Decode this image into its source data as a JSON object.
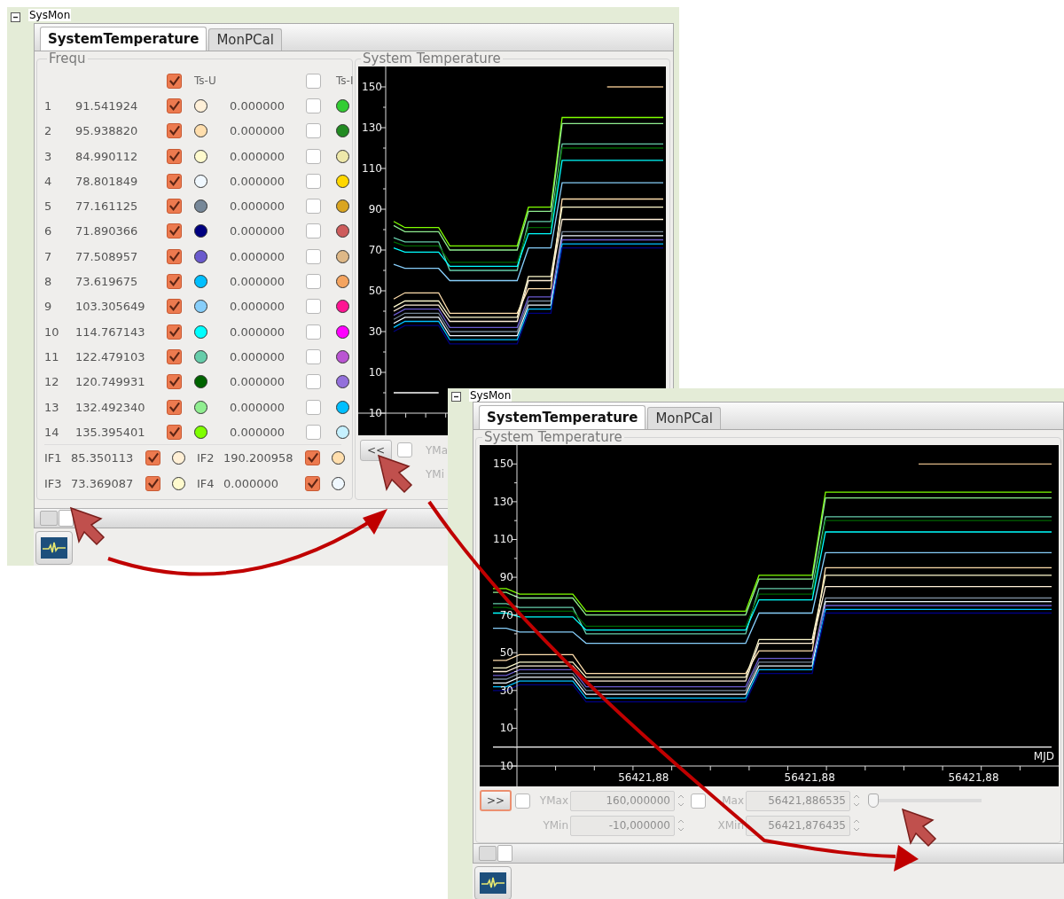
{
  "back_window": {
    "title": "SysMon",
    "tabs": [
      {
        "label": "SystemTemperature",
        "selected": true
      },
      {
        "label": "MonPCal",
        "selected": false
      }
    ],
    "frequency_panel": {
      "title": "Frequ",
      "header": {
        "upper": {
          "checked": true,
          "label": "Ts-U"
        },
        "lower": {
          "checked": false,
          "label": "Ts-I"
        }
      },
      "rows": [
        {
          "index": "1",
          "frequency": "91.541924",
          "upper": {
            "checked": true,
            "color": "#fff0d8"
          },
          "value": "0.000000",
          "lower": {
            "checked": false,
            "color": "#32cd32"
          }
        },
        {
          "index": "2",
          "frequency": "95.938820",
          "upper": {
            "checked": true,
            "color": "#ffdead"
          },
          "value": "0.000000",
          "lower": {
            "checked": false,
            "color": "#228b22"
          }
        },
        {
          "index": "3",
          "frequency": "84.990112",
          "upper": {
            "checked": true,
            "color": "#fffacd"
          },
          "value": "0.000000",
          "lower": {
            "checked": false,
            "color": "#eee8aa"
          }
        },
        {
          "index": "4",
          "frequency": "78.801849",
          "upper": {
            "checked": true,
            "color": "#f0f8ff"
          },
          "value": "0.000000",
          "lower": {
            "checked": false,
            "color": "#ffd700"
          }
        },
        {
          "index": "5",
          "frequency": "77.161125",
          "upper": {
            "checked": true,
            "color": "#778899"
          },
          "value": "0.000000",
          "lower": {
            "checked": false,
            "color": "#daa520"
          }
        },
        {
          "index": "6",
          "frequency": "71.890366",
          "upper": {
            "checked": true,
            "color": "#000080"
          },
          "value": "0.000000",
          "lower": {
            "checked": false,
            "color": "#cd5c5c"
          }
        },
        {
          "index": "7",
          "frequency": "77.508957",
          "upper": {
            "checked": true,
            "color": "#6a5acd"
          },
          "value": "0.000000",
          "lower": {
            "checked": false,
            "color": "#deb887"
          }
        },
        {
          "index": "8",
          "frequency": "73.619675",
          "upper": {
            "checked": true,
            "color": "#00bfff"
          },
          "value": "0.000000",
          "lower": {
            "checked": false,
            "color": "#f4a460"
          }
        },
        {
          "index": "9",
          "frequency": "103.305649",
          "upper": {
            "checked": true,
            "color": "#87cefa"
          },
          "value": "0.000000",
          "lower": {
            "checked": false,
            "color": "#ff1493"
          }
        },
        {
          "index": "10",
          "frequency": "114.767143",
          "upper": {
            "checked": true,
            "color": "#00ffff"
          },
          "value": "0.000000",
          "lower": {
            "checked": false,
            "color": "#ff00ff"
          }
        },
        {
          "index": "11",
          "frequency": "122.479103",
          "upper": {
            "checked": true,
            "color": "#66cdaa"
          },
          "value": "0.000000",
          "lower": {
            "checked": false,
            "color": "#ba55d3"
          }
        },
        {
          "index": "12",
          "frequency": "120.749931",
          "upper": {
            "checked": true,
            "color": "#006400"
          },
          "value": "0.000000",
          "lower": {
            "checked": false,
            "color": "#9370db"
          }
        },
        {
          "index": "13",
          "frequency": "132.492340",
          "upper": {
            "checked": true,
            "color": "#90ee90"
          },
          "value": "0.000000",
          "lower": {
            "checked": false,
            "color": "#00bfff"
          }
        },
        {
          "index": "14",
          "frequency": "135.395401",
          "upper": {
            "checked": true,
            "color": "#7fff00"
          },
          "value": "0.000000",
          "lower": {
            "checked": false,
            "color": "#c6f1ff"
          }
        }
      ],
      "if_rows": [
        {
          "label": "IF1",
          "value": "85.350113",
          "checked": true,
          "color": "#ffefd5"
        },
        {
          "label": "IF2",
          "value": "190.200958",
          "checked": true,
          "color": "#ffdead"
        },
        {
          "label": "IF3",
          "value": "73.369087",
          "checked": true,
          "color": "#fffacd"
        },
        {
          "label": "IF4",
          "value": "0.000000",
          "checked": true,
          "color": "#f0f8ff"
        }
      ]
    },
    "chart_panel": {
      "title": "System Temperature",
      "chart_data": {
        "type": "line",
        "ylim": [
          -10,
          160
        ],
        "categories": [
          null,
          null,
          null,
          null,
          null,
          null,
          null,
          null,
          null,
          null,
          null,
          null,
          null,
          null,
          null,
          null,
          null,
          null,
          null,
          null,
          null,
          null,
          null,
          null,
          null
        ],
        "yticks": [
          150,
          130,
          110,
          90,
          70,
          50,
          30,
          10,
          {
            "value": -10,
            "label": "10"
          }
        ],
        "series": [
          {
            "color": "#7fff00",
            "values": [
              84,
              81,
              81,
              81,
              81,
              72,
              72,
              72,
              72,
              72,
              72,
              72,
              91,
              91,
              91,
              135,
              135,
              135,
              135,
              135,
              135,
              135,
              135,
              135,
              135
            ]
          },
          {
            "color": "#90ee90",
            "values": [
              82,
              79,
              79,
              79,
              79,
              70,
              70,
              70,
              70,
              70,
              70,
              70,
              89,
              89,
              89,
              132,
              132,
              132,
              132,
              132,
              132,
              132,
              132,
              132,
              132
            ]
          },
          {
            "color": "#66cdaa",
            "values": [
              76,
              74,
              74,
              74,
              74,
              60,
              60,
              60,
              60,
              60,
              60,
              60,
              84,
              84,
              84,
              122,
              122,
              122,
              122,
              122,
              122,
              122,
              122,
              122,
              122
            ]
          },
          {
            "color": "#006400",
            "values": [
              74,
              72,
              72,
              72,
              72,
              64,
              64,
              64,
              64,
              64,
              64,
              64,
              81,
              81,
              81,
              120,
              120,
              120,
              120,
              120,
              120,
              120,
              120,
              120,
              120
            ]
          },
          {
            "color": "#00ffff",
            "values": [
              71,
              69,
              69,
              69,
              69,
              62,
              62,
              62,
              62,
              62,
              62,
              62,
              78,
              78,
              78,
              114,
              114,
              114,
              114,
              114,
              114,
              114,
              114,
              114,
              114
            ]
          },
          {
            "color": "#87cefa",
            "values": [
              63,
              61,
              61,
              61,
              61,
              55,
              55,
              55,
              55,
              55,
              55,
              55,
              71,
              71,
              71,
              103,
              103,
              103,
              103,
              103,
              103,
              103,
              103,
              103,
              103
            ]
          },
          {
            "color": "#ffdead",
            "values": [
              46,
              49,
              49,
              49,
              49,
              39,
              39,
              39,
              39,
              39,
              39,
              39,
              51,
              51,
              51,
              95,
              95,
              95,
              95,
              95,
              95,
              95,
              95,
              95,
              95
            ]
          },
          {
            "color": "#fffacd",
            "values": [
              42,
              45,
              45,
              45,
              45,
              37,
              37,
              37,
              37,
              37,
              37,
              37,
              57,
              57,
              57,
              91,
              91,
              91,
              91,
              91,
              91,
              91,
              91,
              91,
              91
            ]
          },
          {
            "color": "#fff0d8",
            "values": [
              40,
              43,
              43,
              43,
              43,
              35,
              35,
              35,
              35,
              35,
              35,
              35,
              55,
              55,
              55,
              85,
              85,
              85,
              85,
              85,
              85,
              85,
              85,
              85,
              85
            ]
          },
          {
            "color": "#deb887",
            "values": [
              null,
              null,
              null,
              null,
              null,
              null,
              null,
              null,
              null,
              null,
              null,
              null,
              null,
              null,
              null,
              null,
              null,
              null,
              null,
              150,
              150,
              150,
              150,
              150,
              150
            ]
          },
          {
            "color": "#778899",
            "values": [
              36,
              39,
              39,
              39,
              39,
              30,
              30,
              30,
              30,
              30,
              30,
              30,
              45,
              45,
              45,
              79,
              79,
              79,
              79,
              79,
              79,
              79,
              79,
              79,
              79
            ]
          },
          {
            "color": "#f0f8ff",
            "values": [
              34,
              37,
              37,
              37,
              37,
              28,
              28,
              28,
              28,
              28,
              28,
              28,
              43,
              43,
              43,
              77,
              77,
              77,
              77,
              77,
              77,
              77,
              77,
              77,
              77
            ]
          },
          {
            "color": "#6a5acd",
            "values": [
              38,
              41,
              41,
              41,
              41,
              32,
              32,
              32,
              32,
              32,
              32,
              32,
              47,
              47,
              47,
              75,
              75,
              75,
              75,
              75,
              75,
              75,
              75,
              75,
              75
            ]
          },
          {
            "color": "#00bfff",
            "values": [
              32,
              35,
              35,
              35,
              35,
              26,
              26,
              26,
              26,
              26,
              26,
              26,
              41,
              41,
              41,
              73,
              73,
              73,
              73,
              73,
              73,
              73,
              73,
              73,
              73
            ]
          },
          {
            "color": "#000080",
            "values": [
              30,
              33,
              33,
              33,
              33,
              24,
              24,
              24,
              24,
              24,
              24,
              24,
              39,
              39,
              39,
              71,
              71,
              71,
              71,
              71,
              71,
              71,
              71,
              71,
              71
            ]
          },
          {
            "color": "#ffffff",
            "values": [
              0,
              0,
              0,
              0,
              0,
              null,
              null,
              null,
              null,
              null,
              null,
              null,
              null,
              null,
              null,
              null,
              null,
              null,
              null,
              null,
              null,
              null,
              null,
              null,
              null
            ]
          }
        ]
      },
      "toggle_button": "<<",
      "toggle_focused": false,
      "y_check": false,
      "ymax_label": "YMa",
      "ymin_label": "YMi"
    }
  },
  "front_window": {
    "title": "SysMon",
    "tabs": [
      {
        "label": "SystemTemperature",
        "selected": true
      },
      {
        "label": "MonPCal",
        "selected": false
      }
    ],
    "chart_panel": {
      "title": "System Temperature",
      "chart_data": {
        "type": "line",
        "ylim": [
          -10,
          160
        ],
        "categories": [
          null,
          null,
          null,
          null,
          null,
          null,
          null,
          null,
          null,
          null,
          null,
          null,
          null,
          null,
          null,
          null,
          null,
          null,
          null,
          null,
          null,
          null,
          null,
          null,
          null,
          null,
          null,
          null,
          null,
          null,
          null,
          null,
          null,
          null,
          null,
          null,
          null,
          null,
          null,
          null,
          null,
          null,
          null
        ],
        "yticks": [
          150,
          130,
          110,
          90,
          70,
          50,
          30,
          10,
          {
            "value": -10,
            "label": "10"
          }
        ],
        "series": [
          {
            "color": "#7fff00",
            "values": [
              84,
              84,
              81,
              81,
              81,
              81,
              81,
              72,
              72,
              72,
              72,
              72,
              72,
              72,
              72,
              72,
              72,
              72,
              72,
              72,
              91,
              91,
              91,
              91,
              91,
              135,
              135,
              135,
              135,
              135,
              135,
              135,
              135,
              135,
              135,
              135,
              135,
              135,
              135,
              135,
              135,
              135,
              135
            ]
          },
          {
            "color": "#90ee90",
            "values": [
              82,
              82,
              79,
              79,
              79,
              79,
              79,
              70,
              70,
              70,
              70,
              70,
              70,
              70,
              70,
              70,
              70,
              70,
              70,
              70,
              89,
              89,
              89,
              89,
              89,
              132,
              132,
              132,
              132,
              132,
              132,
              132,
              132,
              132,
              132,
              132,
              132,
              132,
              132,
              132,
              132,
              132,
              132
            ]
          },
          {
            "color": "#66cdaa",
            "values": [
              76,
              76,
              74,
              74,
              74,
              74,
              74,
              60,
              60,
              60,
              60,
              60,
              60,
              60,
              60,
              60,
              60,
              60,
              60,
              60,
              84,
              84,
              84,
              84,
              84,
              122,
              122,
              122,
              122,
              122,
              122,
              122,
              122,
              122,
              122,
              122,
              122,
              122,
              122,
              122,
              122,
              122,
              122
            ]
          },
          {
            "color": "#006400",
            "values": [
              74,
              74,
              72,
              72,
              72,
              72,
              72,
              64,
              64,
              64,
              64,
              64,
              64,
              64,
              64,
              64,
              64,
              64,
              64,
              64,
              81,
              81,
              81,
              81,
              81,
              120,
              120,
              120,
              120,
              120,
              120,
              120,
              120,
              120,
              120,
              120,
              120,
              120,
              120,
              120,
              120,
              120,
              120
            ]
          },
          {
            "color": "#00ffff",
            "values": [
              71,
              71,
              69,
              69,
              69,
              69,
              69,
              62,
              62,
              62,
              62,
              62,
              62,
              62,
              62,
              62,
              62,
              62,
              62,
              62,
              78,
              78,
              78,
              78,
              78,
              114,
              114,
              114,
              114,
              114,
              114,
              114,
              114,
              114,
              114,
              114,
              114,
              114,
              114,
              114,
              114,
              114,
              114
            ]
          },
          {
            "color": "#87cefa",
            "values": [
              63,
              63,
              61,
              61,
              61,
              61,
              61,
              55,
              55,
              55,
              55,
              55,
              55,
              55,
              55,
              55,
              55,
              55,
              55,
              55,
              71,
              71,
              71,
              71,
              71,
              103,
              103,
              103,
              103,
              103,
              103,
              103,
              103,
              103,
              103,
              103,
              103,
              103,
              103,
              103,
              103,
              103,
              103
            ]
          },
          {
            "color": "#ffdead",
            "values": [
              46,
              46,
              49,
              49,
              49,
              49,
              49,
              39,
              39,
              39,
              39,
              39,
              39,
              39,
              39,
              39,
              39,
              39,
              39,
              39,
              51,
              51,
              51,
              51,
              51,
              95,
              95,
              95,
              95,
              95,
              95,
              95,
              95,
              95,
              95,
              95,
              95,
              95,
              95,
              95,
              95,
              95,
              95
            ]
          },
          {
            "color": "#fffacd",
            "values": [
              42,
              42,
              45,
              45,
              45,
              45,
              45,
              37,
              37,
              37,
              37,
              37,
              37,
              37,
              37,
              37,
              37,
              37,
              37,
              37,
              57,
              57,
              57,
              57,
              57,
              91,
              91,
              91,
              91,
              91,
              91,
              91,
              91,
              91,
              91,
              91,
              91,
              91,
              91,
              91,
              91,
              91,
              91
            ]
          },
          {
            "color": "#fff0d8",
            "values": [
              40,
              40,
              43,
              43,
              43,
              43,
              43,
              35,
              35,
              35,
              35,
              35,
              35,
              35,
              35,
              35,
              35,
              35,
              35,
              35,
              55,
              55,
              55,
              55,
              55,
              85,
              85,
              85,
              85,
              85,
              85,
              85,
              85,
              85,
              85,
              85,
              85,
              85,
              85,
              85,
              85,
              85,
              85
            ]
          },
          {
            "color": "#deb887",
            "values": [
              null,
              null,
              null,
              null,
              null,
              null,
              null,
              null,
              null,
              null,
              null,
              null,
              null,
              null,
              null,
              null,
              null,
              null,
              null,
              null,
              null,
              null,
              null,
              null,
              null,
              null,
              null,
              null,
              null,
              null,
              null,
              null,
              150,
              150,
              150,
              150,
              150,
              150,
              150,
              150,
              150,
              150,
              150
            ]
          },
          {
            "color": "#778899",
            "values": [
              36,
              36,
              39,
              39,
              39,
              39,
              39,
              30,
              30,
              30,
              30,
              30,
              30,
              30,
              30,
              30,
              30,
              30,
              30,
              30,
              45,
              45,
              45,
              45,
              45,
              79,
              79,
              79,
              79,
              79,
              79,
              79,
              79,
              79,
              79,
              79,
              79,
              79,
              79,
              79,
              79,
              79,
              79
            ]
          },
          {
            "color": "#f0f8ff",
            "values": [
              34,
              34,
              37,
              37,
              37,
              37,
              37,
              28,
              28,
              28,
              28,
              28,
              28,
              28,
              28,
              28,
              28,
              28,
              28,
              28,
              43,
              43,
              43,
              43,
              43,
              77,
              77,
              77,
              77,
              77,
              77,
              77,
              77,
              77,
              77,
              77,
              77,
              77,
              77,
              77,
              77,
              77,
              77
            ]
          },
          {
            "color": "#6a5acd",
            "values": [
              38,
              38,
              41,
              41,
              41,
              41,
              41,
              32,
              32,
              32,
              32,
              32,
              32,
              32,
              32,
              32,
              32,
              32,
              32,
              32,
              47,
              47,
              47,
              47,
              47,
              75,
              75,
              75,
              75,
              75,
              75,
              75,
              75,
              75,
              75,
              75,
              75,
              75,
              75,
              75,
              75,
              75,
              75
            ]
          },
          {
            "color": "#00bfff",
            "values": [
              32,
              32,
              35,
              35,
              35,
              35,
              35,
              26,
              26,
              26,
              26,
              26,
              26,
              26,
              26,
              26,
              26,
              26,
              26,
              26,
              41,
              41,
              41,
              41,
              41,
              73,
              73,
              73,
              73,
              73,
              73,
              73,
              73,
              73,
              73,
              73,
              73,
              73,
              73,
              73,
              73,
              73,
              73
            ]
          },
          {
            "color": "#000080",
            "values": [
              30,
              30,
              33,
              33,
              33,
              33,
              33,
              24,
              24,
              24,
              24,
              24,
              24,
              24,
              24,
              24,
              24,
              24,
              24,
              24,
              39,
              39,
              39,
              39,
              39,
              71,
              71,
              71,
              71,
              71,
              71,
              71,
              71,
              71,
              71,
              71,
              71,
              71,
              71,
              71,
              71,
              71,
              71
            ]
          },
          {
            "color": "#ffffff",
            "values": [
              0,
              0,
              0,
              0,
              0,
              0,
              0,
              0,
              0,
              0,
              0,
              0,
              0,
              0,
              0,
              0,
              0,
              0,
              0,
              0,
              0,
              0,
              0,
              0,
              0,
              0,
              0,
              0,
              0,
              0,
              0,
              0,
              0,
              0,
              0,
              0,
              0,
              0,
              0,
              0,
              0,
              0,
              0
            ]
          }
        ]
      },
      "x_tick_labels": [
        "56421,88",
        "56421,88",
        "56421,88"
      ],
      "x_unit": "MJD",
      "toggle_button": ">>",
      "toggle_focused": true,
      "y_check": false,
      "ymax_label": "YMax",
      "ymax_field": {
        "value": "160,000000",
        "disabled": true
      },
      "x_check": false,
      "xmax_label": "Max",
      "xmax_field": {
        "value": "56421,886535",
        "disabled": true
      },
      "zoom_slider": {
        "level": 0
      },
      "ymin_label": "YMin",
      "ymin_field": {
        "value": "-10,000000",
        "disabled": true
      },
      "xmin_label": "XMin",
      "xmin_field": {
        "value": "56421,876435",
        "disabled": true
      }
    }
  }
}
